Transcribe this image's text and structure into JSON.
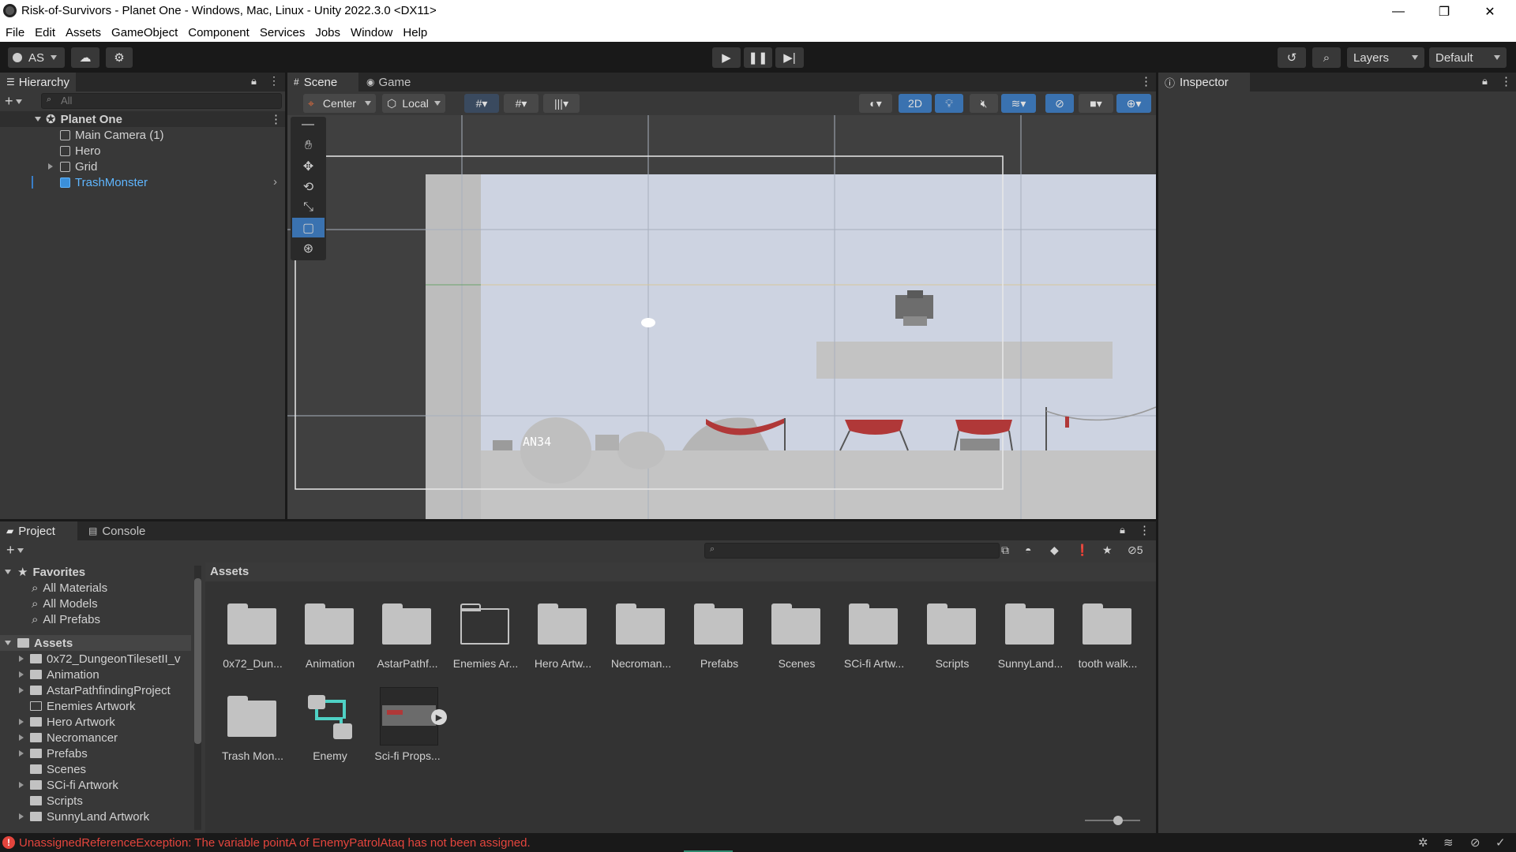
{
  "window": {
    "title": "Risk-of-Survivors - Planet One - Windows, Mac, Linux - Unity 2022.3.0 <DX11>",
    "minimize": "—",
    "restore": "❐",
    "close": "✕"
  },
  "menu": [
    "File",
    "Edit",
    "Assets",
    "GameObject",
    "Component",
    "Services",
    "Jobs",
    "Window",
    "Help"
  ],
  "toolbar": {
    "account": "AS",
    "layers": "Layers",
    "layout": "Default"
  },
  "hierarchy": {
    "tab": "Hierarchy",
    "search_placeholder": "All",
    "scene": "Planet One",
    "items": [
      {
        "label": "Main Camera (1)"
      },
      {
        "label": "Hero"
      },
      {
        "label": "Grid"
      },
      {
        "label": "TrashMonster"
      }
    ]
  },
  "scene": {
    "tab_scene": "Scene",
    "tab_game": "Game",
    "pivot": "Center",
    "space": "Local",
    "mode2d": "2D",
    "sprite_text": "AN34"
  },
  "inspector": {
    "tab": "Inspector"
  },
  "project": {
    "tab_project": "Project",
    "tab_console": "Console",
    "hidden_count": "5",
    "breadcrumb": "Assets",
    "favorites": {
      "label": "Favorites",
      "items": [
        "All Materials",
        "All Models",
        "All Prefabs"
      ]
    },
    "tree": {
      "label": "Assets",
      "items": [
        "0x72_DungeonTilesetII_v",
        "Animation",
        "AstarPathfindingProject",
        "Enemies Artwork",
        "Hero Artwork",
        "Necromancer",
        "Prefabs",
        "Scenes",
        "SCi-fi Artwork",
        "Scripts",
        "SunnyLand Artwork"
      ]
    },
    "assets": [
      {
        "label": "0x72_Dun..."
      },
      {
        "label": "Animation"
      },
      {
        "label": "AstarPathf..."
      },
      {
        "label": "Enemies Ar..."
      },
      {
        "label": "Hero Artw..."
      },
      {
        "label": "Necroman..."
      },
      {
        "label": "Prefabs"
      },
      {
        "label": "Scenes"
      },
      {
        "label": "SCi-fi Artw..."
      },
      {
        "label": "Scripts"
      },
      {
        "label": "SunnyLand..."
      },
      {
        "label": "tooth walk..."
      },
      {
        "label": "Trash Mon..."
      },
      {
        "label": "Enemy"
      },
      {
        "label": "Sci-fi Props..."
      }
    ]
  },
  "status": {
    "error": "UnassignedReferenceException: The variable pointA of EnemyPatrolAtaq has not been assigned."
  },
  "colors": {
    "panel": "#383838",
    "dark": "#191919",
    "selection_text": "#5fb6ff",
    "sky": "#cdd3e1",
    "error": "#e4453d",
    "accent_blue": "#3a72b0"
  }
}
